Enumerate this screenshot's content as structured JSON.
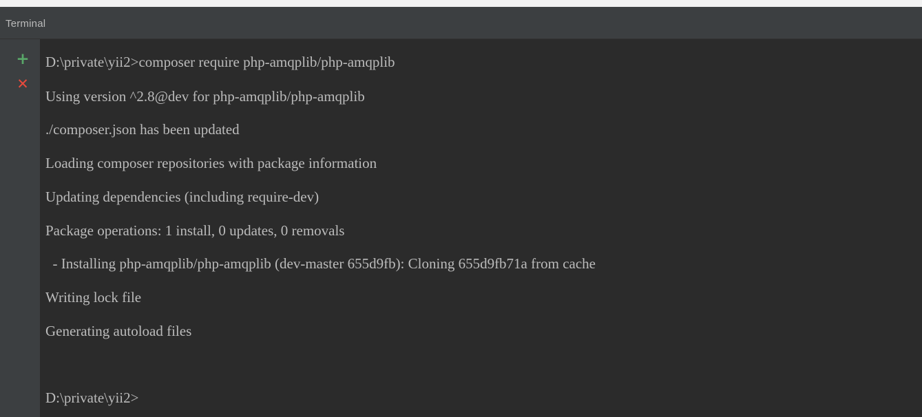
{
  "panel": {
    "title": "Terminal"
  },
  "toolbar": {
    "new_session_icon": "+",
    "close_session_icon": "✕"
  },
  "terminal": {
    "lines": [
      "D:\\private\\yii2>composer require php-amqplib/php-amqplib",
      "Using version ^2.8@dev for php-amqplib/php-amqplib",
      "./composer.json has been updated",
      "Loading composer repositories with package information",
      "Updating dependencies (including require-dev)",
      "Package operations: 1 install, 0 updates, 0 removals",
      "  - Installing php-amqplib/php-amqplib (dev-master 655d9fb): Cloning 655d9fb71a from cache",
      "Writing lock file",
      "Generating autoload files",
      "",
      "D:\\private\\yii2>"
    ]
  },
  "colors": {
    "background": "#2b2b2b",
    "panel": "#3c3f41",
    "text": "#bbbbbb",
    "add_icon": "#59a869",
    "close_icon": "#e84a3c"
  }
}
